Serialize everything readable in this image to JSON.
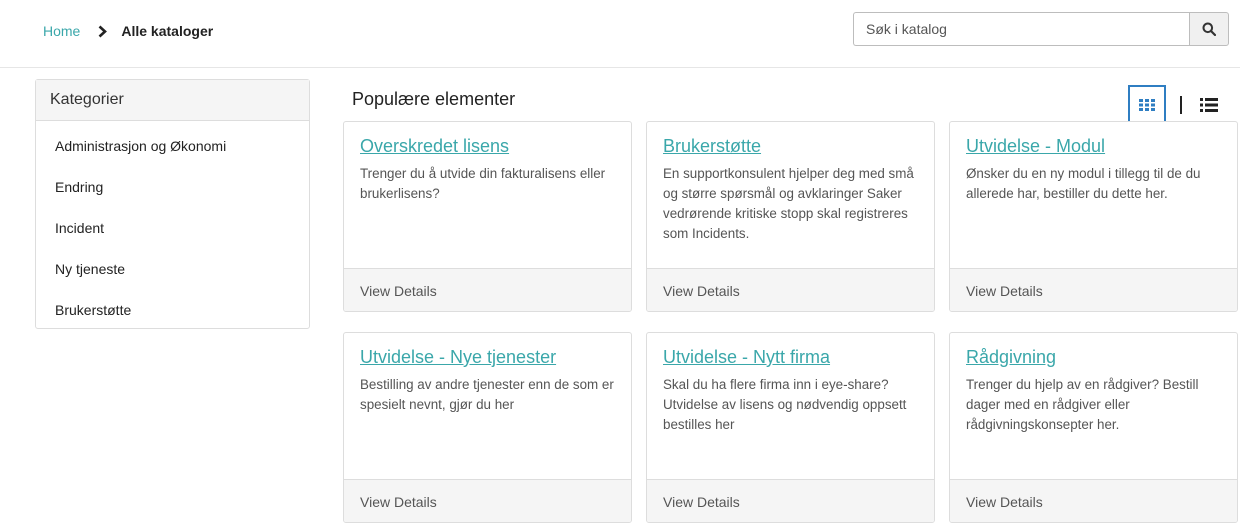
{
  "breadcrumb": {
    "home": "Home",
    "current": "Alle kataloger"
  },
  "search": {
    "placeholder": "Søk i katalog"
  },
  "sidebar": {
    "header": "Kategorier",
    "items": [
      {
        "label": "Administrasjon og Økonomi"
      },
      {
        "label": "Endring"
      },
      {
        "label": "Incident"
      },
      {
        "label": "Ny tjeneste"
      },
      {
        "label": "Brukerstøtte"
      }
    ]
  },
  "main": {
    "title": "Populære elementer",
    "cards": [
      {
        "title": "Overskredet lisens",
        "description": "Trenger du å utvide din fakturalisens eller brukerlisens?",
        "footer": "View Details"
      },
      {
        "title": "Brukerstøtte",
        "description": "En supportkonsulent hjelper deg med små og større spørsmål og avklaringer Saker vedrørende kritiske stopp skal registreres som Incidents.",
        "footer": "View Details"
      },
      {
        "title": "Utvidelse - Modul",
        "description": "Ønsker du en ny modul i tillegg til de du allerede har, bestiller du dette her.",
        "footer": "View Details"
      },
      {
        "title": "Utvidelse - Nye tjenester",
        "description": "Bestilling av andre tjenester enn de som er spesielt nevnt, gjør du her",
        "footer": "View Details"
      },
      {
        "title": "Utvidelse - Nytt firma",
        "description": "Skal du ha flere firma inn i eye-share? Utvidelse av lisens og nødvendig oppsett bestilles her",
        "footer": "View Details"
      },
      {
        "title": "Rådgivning",
        "description": "Trenger du hjelp av en rådgiver? Bestill dager med en rådgiver eller rådgivningskonsepter her.",
        "footer": "View Details"
      }
    ]
  },
  "colors": {
    "accent": "#3aa7aa",
    "toggle_active_border": "#2f7ec2",
    "panel_bg": "#f5f5f5"
  },
  "icons": {
    "breadcrumb_separator": "chevron-right-icon",
    "search": "search-icon",
    "grid_view": "grid-view-icon",
    "list_view": "list-view-icon"
  }
}
